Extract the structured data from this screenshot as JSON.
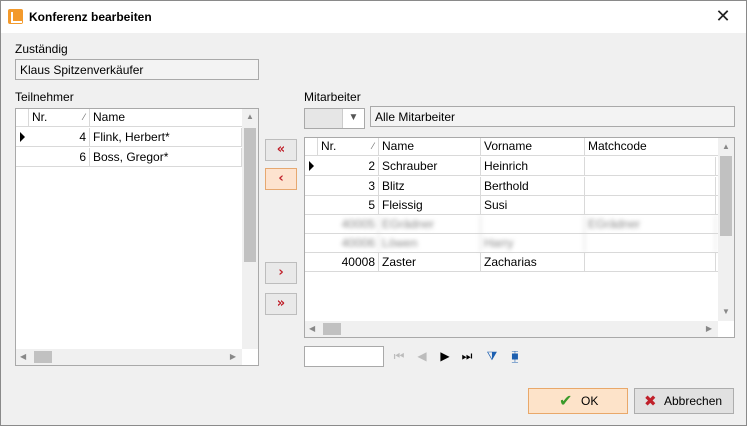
{
  "window": {
    "title": "Konferenz bearbeiten",
    "close_glyph": "✕"
  },
  "zustaendig": {
    "label": "Zuständig",
    "value": "Klaus Spitzenverkäufer"
  },
  "teilnehmer": {
    "label": "Teilnehmer",
    "columns": [
      "Nr.",
      "Name"
    ],
    "rows": [
      {
        "nr": "4",
        "name": "Flink, Herbert*"
      },
      {
        "nr": "6",
        "name": "Boss, Gregor*"
      }
    ]
  },
  "mitarbeiter": {
    "label": "Mitarbeiter",
    "filter_value": "Alle Mitarbeiter",
    "columns": [
      "Nr.",
      "Name",
      "Vorname",
      "Matchcode"
    ],
    "rows": [
      {
        "nr": "2",
        "name": "Schrauber",
        "vorname": "Heinrich",
        "matchcode": ""
      },
      {
        "nr": "3",
        "name": "Blitz",
        "vorname": "Berthold",
        "matchcode": ""
      },
      {
        "nr": "5",
        "name": "Fleissig",
        "vorname": "Susi",
        "matchcode": ""
      },
      {
        "nr": "40005",
        "name": "EGrädner",
        "vorname": "",
        "matchcode": "EGrädner",
        "blurred": true
      },
      {
        "nr": "40006",
        "name": "Löwen",
        "vorname": "Harry",
        "matchcode": "",
        "blurred": true
      },
      {
        "nr": "40008",
        "name": "Zaster",
        "vorname": "Zacharias",
        "matchcode": ""
      }
    ]
  },
  "move_buttons": {
    "add_all": "«",
    "add_one": "‹",
    "remove_one": "›",
    "remove_all": "»"
  },
  "buttons": {
    "ok": "OK",
    "cancel": "Abbrechen"
  },
  "colors": {
    "accent": "#c0202a",
    "ok_bg": "#fde3c9",
    "ok_check": "#3a9a2a"
  },
  "icons": [
    "app-icon",
    "close-icon",
    "sort-icon",
    "row-indicator-icon",
    "double-left-arrow-icon",
    "left-arrow-icon",
    "right-arrow-icon",
    "double-right-arrow-icon",
    "nav-first-icon",
    "nav-prev-icon",
    "nav-next-icon",
    "nav-last-icon",
    "filter-icon",
    "filter-clear-icon",
    "checkmark-icon",
    "cancel-x-icon"
  ]
}
